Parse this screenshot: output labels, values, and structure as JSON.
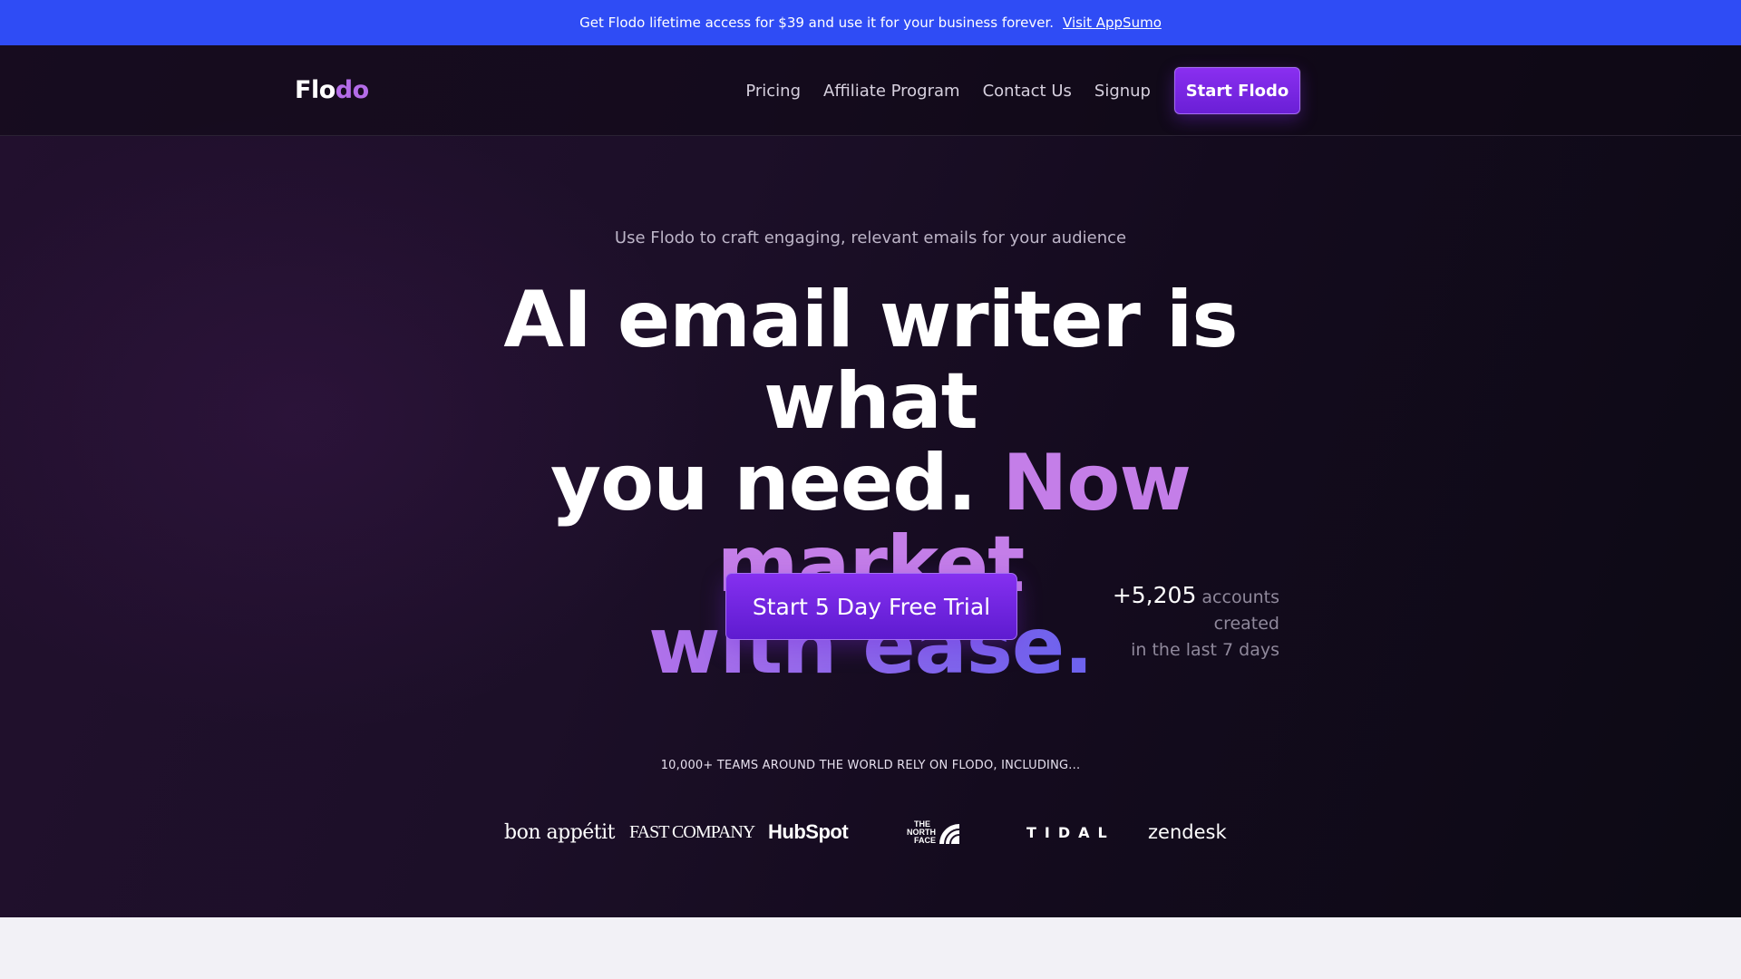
{
  "promo": {
    "text": "Get Flodo lifetime access for $39 and use it for your business forever.",
    "link": "Visit AppSumo"
  },
  "nav": {
    "logo_main": "Flo",
    "logo_accent": "do",
    "links": [
      "Pricing",
      "Affiliate Program",
      "Contact Us",
      "Signup"
    ],
    "cta": "Start Flodo"
  },
  "hero": {
    "subtitle": "Use Flodo to craft engaging, relevant emails for your audience",
    "headline_line1": "AI email writer is what",
    "headline_line2_white": "you need.",
    "headline_line2_purple": "Now market",
    "headline_line3": "with ease.",
    "cta": "Start 5 Day Free Trial",
    "accounts_count": "+5,205",
    "accounts_text_1": "accounts created",
    "accounts_text_2": "in the last 7 days"
  },
  "social_proof": {
    "label": "10,000+ TEAMS AROUND THE WORLD RELY ON FLODO, INCLUDING...",
    "brands": {
      "bon_appetit": "bon appétit",
      "fast_company": "FAST COMPANY",
      "hubspot": "HubSpot",
      "north_face_1": "THE",
      "north_face_2": "NORTH",
      "north_face_3": "FACE",
      "tidal": "TIDAL",
      "zendesk": "zendesk"
    }
  },
  "colors": {
    "promo_bg": "#2f4cf5",
    "accent_purple": "#8a2ff0",
    "logo_accent": "#b46ce8"
  }
}
